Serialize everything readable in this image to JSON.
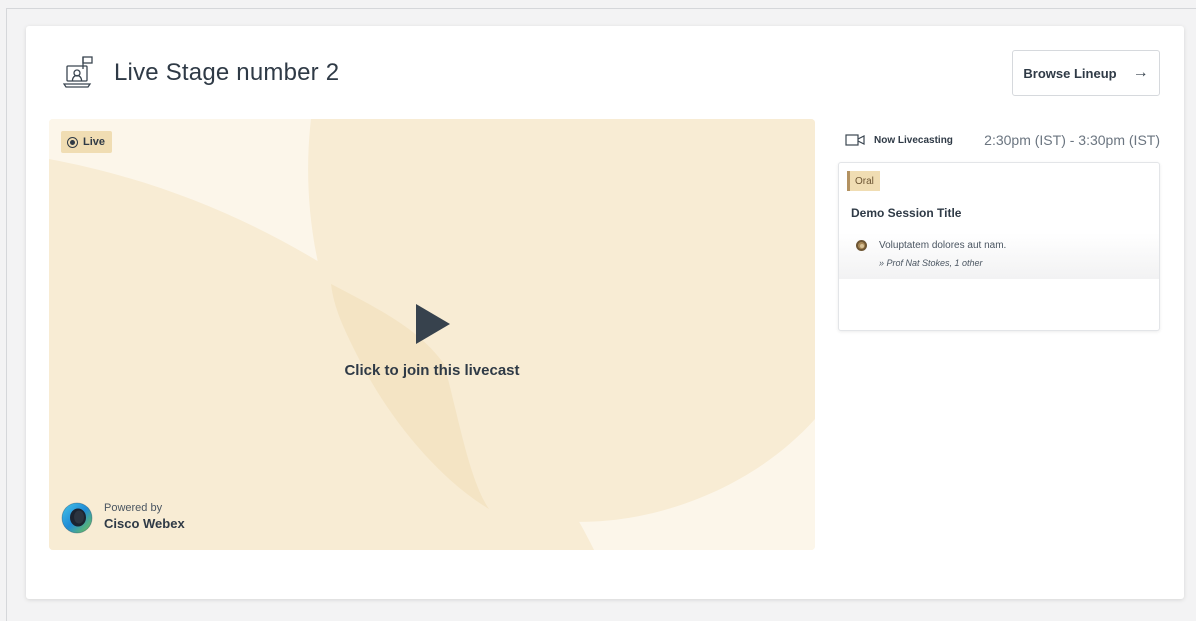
{
  "stage": {
    "title": "Live Stage number 2",
    "icon": "stage-presenter-icon"
  },
  "header": {
    "browse_label": "Browse Lineup",
    "browse_arrow": "→"
  },
  "player": {
    "live_label": "Live",
    "join_label": "Click to join this livecast",
    "powered_by": "Powered by",
    "provider": "Cisco Webex",
    "background_color": "#f9efdb",
    "accent_color": "#f0ddb3"
  },
  "now": {
    "label": "Now Livecasting",
    "time_range": "2:30pm (IST) - 3:30pm (IST)"
  },
  "session": {
    "tag": "Oral",
    "title": "Demo Session Title",
    "speaker_line": "Voluptatem dolores aut nam.",
    "speaker_names": "» Prof Nat Stokes, 1 other"
  }
}
